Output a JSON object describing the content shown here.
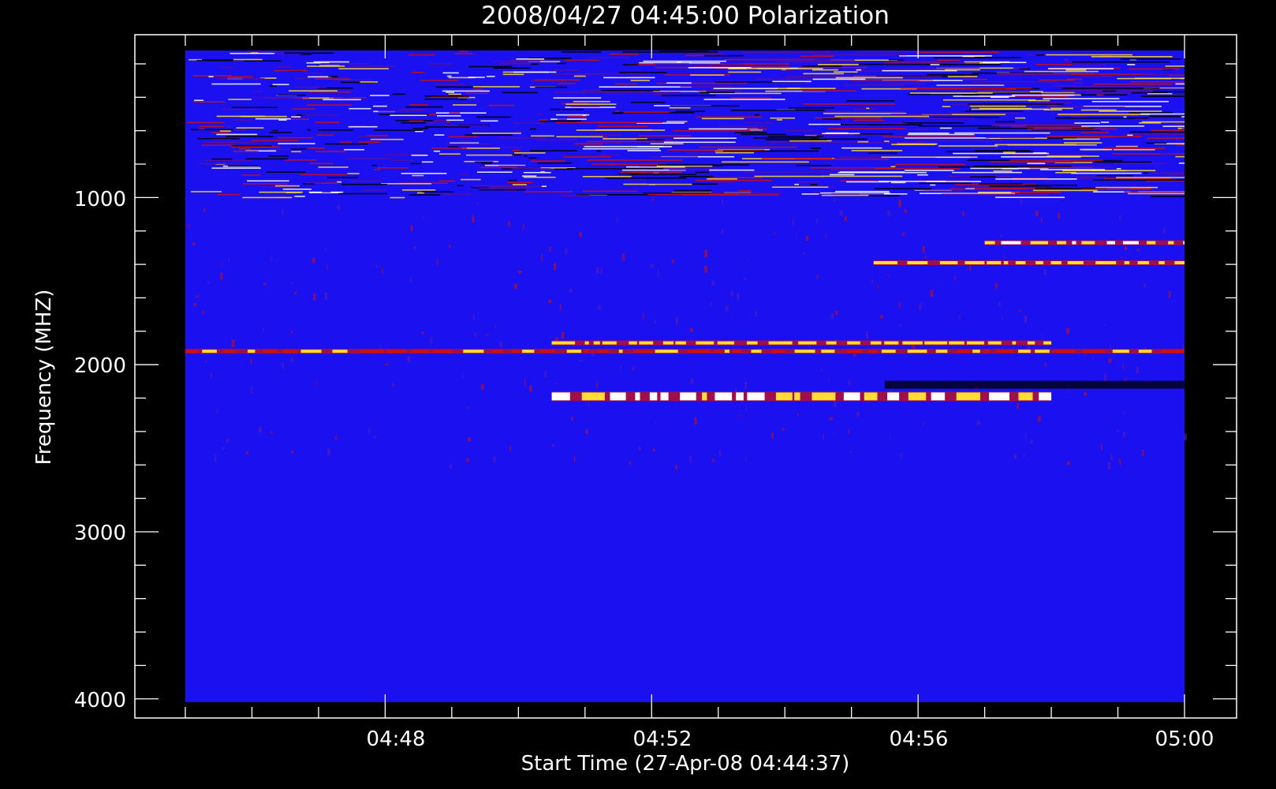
{
  "chart_data": {
    "type": "heatmap",
    "title": "2008/04/27 04:45:00 Polarization",
    "xlabel": "Start Time (27-Apr-08 04:44:37)",
    "ylabel": "Frequency (MHZ)",
    "x_ticks": [
      "04:48",
      "04:52",
      "04:56",
      "05:00"
    ],
    "y_ticks": [
      "1000",
      "2000",
      "3000",
      "4000"
    ],
    "xlim": [
      "04:45:00",
      "05:00:00"
    ],
    "ylim": [
      120,
      4020
    ],
    "y_inverted": true,
    "grid": false,
    "colorscale": {
      "background": "#1a10f0",
      "low": "#000000",
      "mid": "#cc1010",
      "high": "#ffdd33",
      "max": "#ffffff"
    },
    "features": [
      {
        "label": "scattered emission band",
        "freq_range_mhz": [
          120,
          1000
        ],
        "time_range": [
          "04:45:00",
          "05:00:00"
        ]
      },
      {
        "label": "narrow band",
        "freq_mhz": 1390,
        "time_range": [
          "04:55:20",
          "05:00:00"
        ],
        "intensity": "high"
      },
      {
        "label": "narrow band",
        "freq_mhz": 1270,
        "time_range": [
          "04:57:00",
          "05:00:00"
        ],
        "intensity": "max"
      },
      {
        "label": "narrow band",
        "freq_mhz": 1920,
        "time_range": [
          "04:45:00",
          "05:00:00"
        ],
        "intensity": "mid"
      },
      {
        "label": "narrow band",
        "freq_mhz": 1870,
        "time_range": [
          "04:50:30",
          "04:58:00"
        ],
        "intensity": "high"
      },
      {
        "label": "burst band",
        "freq_mhz": 2190,
        "time_range": [
          "04:50:30",
          "04:58:00"
        ],
        "intensity": "max"
      },
      {
        "label": "dark band",
        "freq_mhz": 2120,
        "time_range": [
          "04:55:30",
          "05:00:00"
        ],
        "intensity": "low"
      }
    ]
  }
}
